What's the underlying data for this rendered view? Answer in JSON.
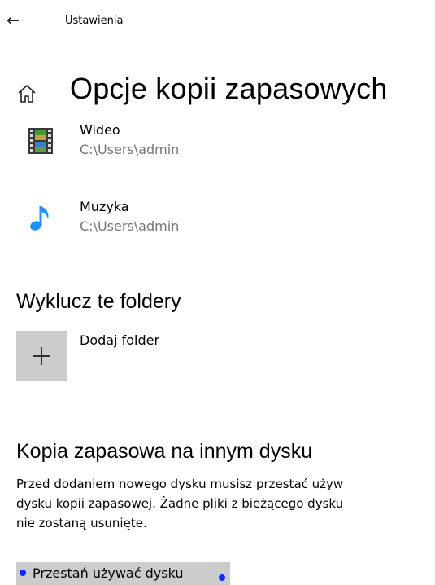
{
  "header": {
    "app_title": "Ustawienia",
    "back_icon": "arrow-left-icon"
  },
  "page": {
    "title": "Opcje kopii zapasowych",
    "icon": "home-icon"
  },
  "folders": [
    {
      "name": "Wideo",
      "path": "C:\\Users\\admin",
      "icon": "video-film-icon"
    },
    {
      "name": "Muzyka",
      "path": "C:\\Users\\admin",
      "icon": "music-note-icon"
    }
  ],
  "exclude": {
    "heading": "Wyklucz te foldery",
    "add_label": "Dodaj folder",
    "add_icon": "plus-icon"
  },
  "other_drive": {
    "heading": "Kopia zapasowa na innym dysku",
    "description_lines": [
      "Przed dodaniem nowego dysku musisz przestać używ",
      "dysku kopii zapasowej. Żadne pliki z bieżącego dysku",
      "nie zostaną usunięte."
    ],
    "stop_button_label": "Przestań używać dysku"
  },
  "colors": {
    "tile_gray": "#cccccc",
    "path_gray": "#767676",
    "music_blue": "#1e90ff",
    "focus_dot_blue": "#0a2cff"
  }
}
